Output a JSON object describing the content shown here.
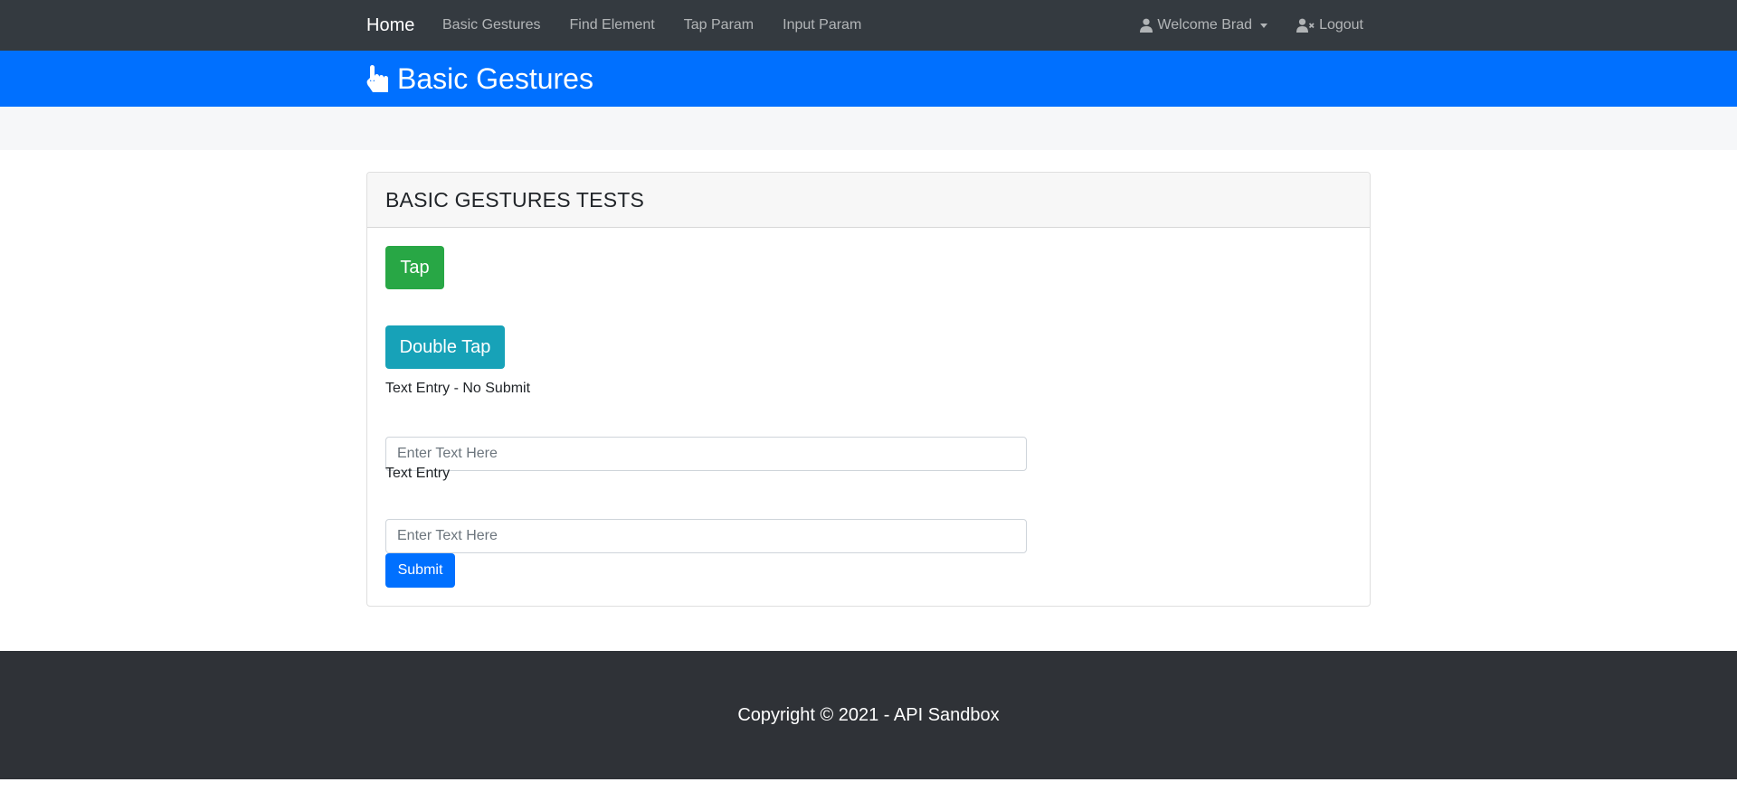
{
  "nav": {
    "brand": "Home",
    "links": [
      "Basic Gestures",
      "Find Element",
      "Tap Param",
      "Input Param"
    ],
    "user_menu": "Welcome Brad",
    "logout": "Logout"
  },
  "banner": {
    "icon": "pointer-hand-icon",
    "title": "Basic Gestures"
  },
  "card": {
    "title": "BASIC GESTURES TESTS",
    "tap_label": "Tap",
    "double_tap_label": "Double Tap",
    "field1": {
      "label": "Text Entry - No Submit",
      "placeholder": "Enter Text Here",
      "value": ""
    },
    "field2": {
      "label": "Text Entry",
      "placeholder": "Enter Text Here",
      "value": ""
    },
    "submit_label": "Submit"
  },
  "footer": {
    "text": "Copyright © 2021 - API Sandbox"
  },
  "colors": {
    "navbar": "#343a40",
    "banner": "#0070ff",
    "tap_button": "#28a745",
    "double_tap_button": "#17a2b8",
    "submit_button": "#0070ff",
    "footer": "#2f3237"
  }
}
